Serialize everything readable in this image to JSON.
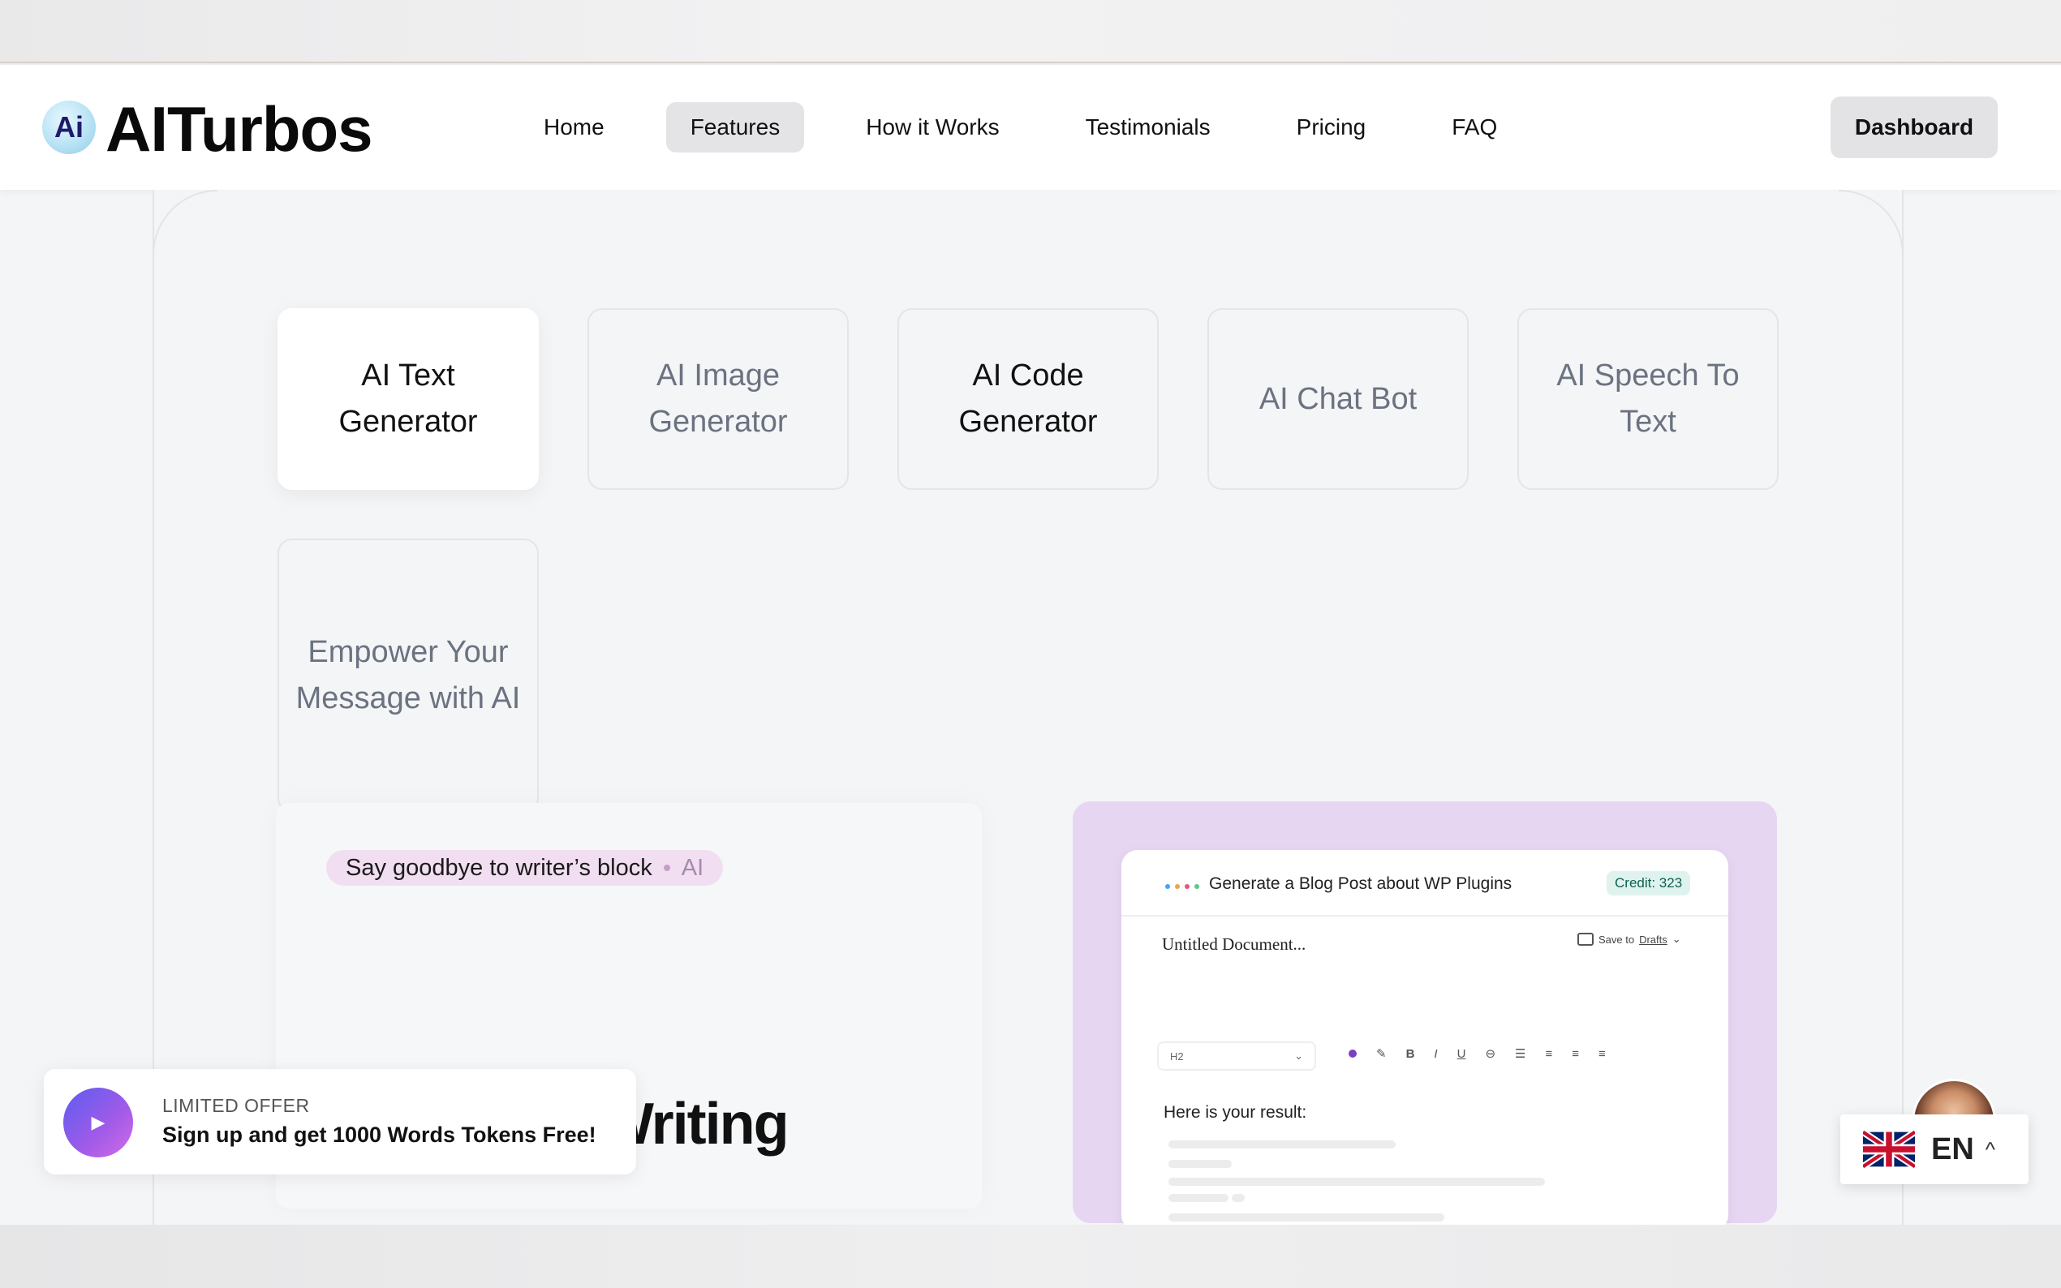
{
  "header": {
    "logo_badge": "Ai",
    "logo_text": "AITurbos",
    "nav": [
      {
        "label": "Home",
        "active": false
      },
      {
        "label": "Features",
        "active": true
      },
      {
        "label": "How it Works",
        "active": false
      },
      {
        "label": "Testimonials",
        "active": false
      },
      {
        "label": "Pricing",
        "active": false
      },
      {
        "label": "FAQ",
        "active": false
      }
    ],
    "dashboard_label": "Dashboard"
  },
  "feature_tiles": [
    {
      "label": "AI Text Generator",
      "state": "active"
    },
    {
      "label": "AI Image Generator",
      "state": "muted"
    },
    {
      "label": "AI Code Generator",
      "state": "dark"
    },
    {
      "label": "AI Chat Bot",
      "state": "muted"
    },
    {
      "label": "AI Speech To Text",
      "state": "muted"
    },
    {
      "label": "Empower Your Message with AI",
      "state": "muted"
    }
  ],
  "left_card": {
    "pill_text": "Say goodbye to writer’s block",
    "pill_tag": "AI",
    "headline": "Intelligent Writing"
  },
  "mock": {
    "title": "Generate a Blog Post about WP Plugins",
    "credit": "Credit: 323",
    "doc_title": "Untitled Document...",
    "save_prefix": "Save to",
    "save_target": "Drafts",
    "heading_select": "H2",
    "toolbar": [
      "B",
      "I",
      "U"
    ],
    "result_label": "Here is your result:",
    "dot_colors": [
      "#4aa3f0",
      "#f0a24a",
      "#e05a7a",
      "#5ac88a"
    ],
    "accent": "#7c3fc2"
  },
  "offer": {
    "kicker": "LIMITED OFFER",
    "text": "Sign up and get 1000 Words Tokens Free!"
  },
  "language": {
    "code": "EN",
    "flag_icon": "uk-flag-icon"
  }
}
